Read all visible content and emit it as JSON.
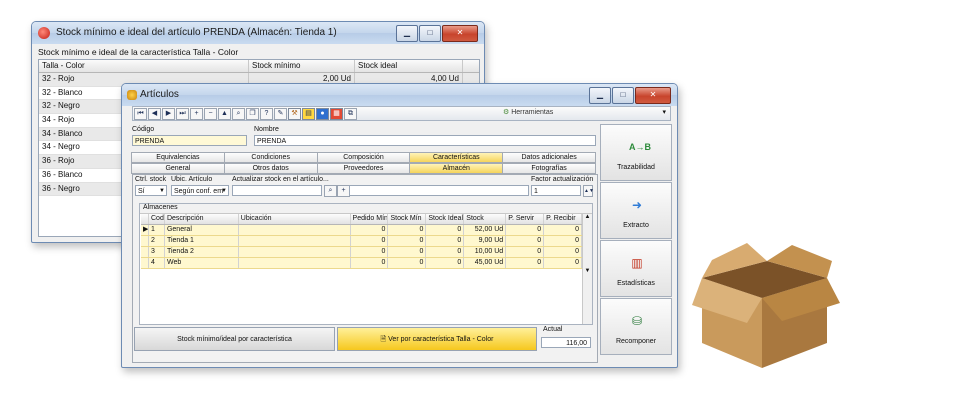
{
  "back_window": {
    "title": "Stock mínimo e ideal del artículo PRENDA (Almacén: Tienda 1)",
    "subtitle": "Stock mínimo e ideal de la característica Talla - Color",
    "columns": [
      "Talla - Color",
      "Stock mínimo",
      "Stock ideal"
    ],
    "rows": [
      {
        "talla": "32 - Rojo",
        "min": "2,00 Ud",
        "ideal": "4,00 Ud"
      },
      {
        "talla": "32 - Blanco",
        "min": "",
        "ideal": ""
      },
      {
        "talla": "32 - Negro",
        "min": "",
        "ideal": ""
      },
      {
        "talla": "34 - Rojo",
        "min": "",
        "ideal": ""
      },
      {
        "talla": "34 - Blanco",
        "min": "",
        "ideal": ""
      },
      {
        "talla": "34 - Negro",
        "min": "",
        "ideal": ""
      },
      {
        "talla": "36 - Rojo",
        "min": "",
        "ideal": ""
      },
      {
        "talla": "36 - Blanco",
        "min": "",
        "ideal": ""
      },
      {
        "talla": "36 - Negro",
        "min": "",
        "ideal": ""
      }
    ]
  },
  "front_window": {
    "title": "Artículos",
    "tools_label": "Herramientas",
    "codigo_label": "Código",
    "codigo_value": "PRENDA",
    "nombre_label": "Nombre",
    "nombre_value": "PRENDA",
    "tabs_row1": [
      "Equivalencias",
      "Condiciones",
      "Composición",
      "Características",
      "Datos adicionales"
    ],
    "tabs_row2": [
      "General",
      "Otros datos",
      "Proveedores",
      "Almacén",
      "Fotografías"
    ],
    "ctrl_stock_label": "Ctrl. stock",
    "ctrl_stock_value": "Sí",
    "ubic_label": "Ubic. Artículo",
    "ubic_value": "Según conf. em",
    "actualizar_label": "Actualizar stock en el artículo...",
    "factor_label": "Factor actualización",
    "factor_value": "1",
    "almacenes_label": "Almacenes",
    "almacen_columns": [
      "Cod",
      "Descripción",
      "Ubicación",
      "Pedido Mín",
      "Stock Mín",
      "Stock Ideal",
      "Stock",
      "P. Servir",
      "P. Recibir"
    ],
    "almacen_rows": [
      {
        "cod": "1",
        "desc": "General",
        "ubic": "",
        "ped": "0",
        "smin": "0",
        "sideal": "0",
        "stock": "52,00 Ud",
        "serv": "0",
        "rec": "0"
      },
      {
        "cod": "2",
        "desc": "Tienda 1",
        "ubic": "",
        "ped": "0",
        "smin": "0",
        "sideal": "0",
        "stock": "9,00 Ud",
        "serv": "0",
        "rec": "0"
      },
      {
        "cod": "3",
        "desc": "Tienda 2",
        "ubic": "",
        "ped": "0",
        "smin": "0",
        "sideal": "0",
        "stock": "10,00 Ud",
        "serv": "0",
        "rec": "0"
      },
      {
        "cod": "4",
        "desc": "Web",
        "ubic": "",
        "ped": "0",
        "smin": "0",
        "sideal": "0",
        "stock": "45,00 Ud",
        "serv": "0",
        "rec": "0"
      }
    ],
    "btn_stock_minimo": "Stock mínimo/ideal por característica",
    "btn_ver": "Ver por característica Talla - Color",
    "actual_label": "Actual",
    "actual_value": "116,00",
    "side_buttons": [
      "Trazabilidad",
      "Extracto",
      "Estadísticas",
      "Recomponer"
    ]
  },
  "colors": {
    "accent_yellow": "#f6c81e",
    "row_yellow": "#fff8cf",
    "title_blue": "#c4d6ec"
  }
}
